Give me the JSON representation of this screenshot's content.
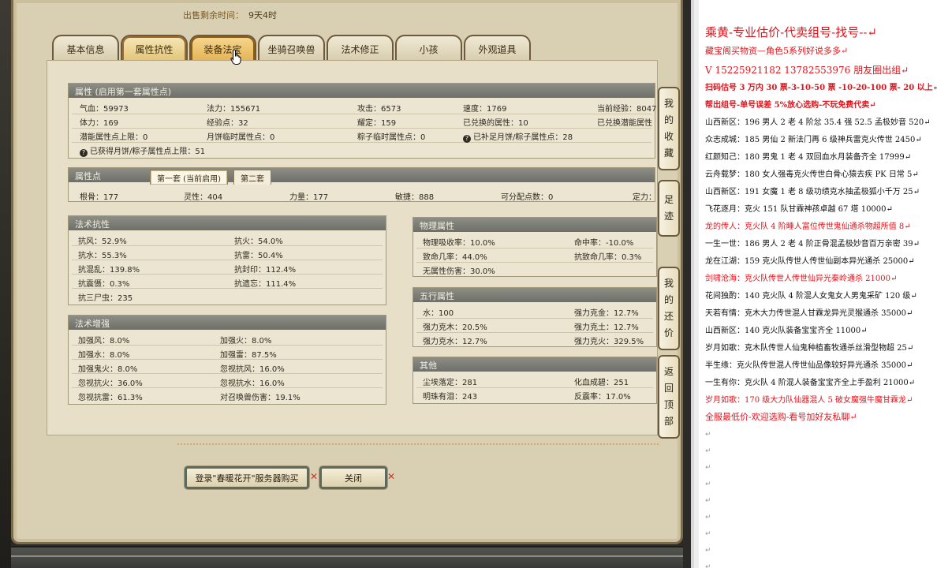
{
  "game": {
    "sale_time_label": "出售剩余时间：",
    "sale_time_value": "9天4时",
    "tabs": [
      "基本信息",
      "属性抗性",
      "装备法宝",
      "坐骑召唤兽",
      "法术修正",
      "小孩",
      "外观道具"
    ],
    "active_tab": "装备法宝",
    "attributes": {
      "header": "属性 (启用第一套属性点)",
      "rows": [
        [
          "气血：59973",
          "法力：155671",
          "攻击：6573",
          "速度：1769",
          "当前经验：8047"
        ],
        [
          "体力：169",
          "经验点：32",
          "耀定：159",
          "已兑换的属性：10",
          "已兑换潜能属性"
        ],
        [
          "潜能属性点上限：0",
          "月饼临时属性点：0",
          "粽子临时属性点：0",
          "已补足月饼/粽子属性点：28",
          ""
        ]
      ],
      "note": "已获得月饼/粽子属性点上限：51"
    },
    "points": {
      "header": "属性点",
      "subtabs": [
        "第一套 (当前启用)",
        "第二套"
      ],
      "row": [
        "根骨：177",
        "灵性：404",
        "力量：177",
        "敏捷：888",
        "可分配点数：0",
        "定力："
      ]
    },
    "resist": {
      "header": "法术抗性",
      "rows": [
        [
          "抗风：52.9%",
          "抗火：54.0%"
        ],
        [
          "抗水：55.3%",
          "抗雷：50.4%"
        ],
        [
          "抗混乱：139.8%",
          "抗封印：112.4%"
        ],
        [
          "抗震慑：0.3%",
          "抗遗忘：111.4%"
        ],
        [
          "抗三尸虫：235",
          ""
        ]
      ]
    },
    "boost": {
      "header": "法术增强",
      "rows": [
        [
          "加强风：8.0%",
          "加强火：8.0%"
        ],
        [
          "加强水：8.0%",
          "加强雷：87.5%"
        ],
        [
          "加强鬼火：8.0%",
          "忽视抗风：16.0%"
        ],
        [
          "忽视抗火：36.0%",
          "忽视抗水：16.0%"
        ],
        [
          "忽视抗雷：61.3%",
          "对召唤兽伤害：19.1%"
        ]
      ]
    },
    "physical": {
      "header": "物理属性",
      "rows": [
        [
          "物理吸收率：10.0%",
          "命中率：-10.0%"
        ],
        [
          "致命几率：44.0%",
          "抗致命几率：0.3%"
        ],
        [
          "无属性伤害：30.0%",
          ""
        ]
      ]
    },
    "wuxing": {
      "header": "五行属性",
      "rows": [
        [
          "水：100",
          "强力克金：12.7%"
        ],
        [
          "强力克木：20.5%",
          "强力克土：12.7%"
        ],
        [
          "强力克水：12.7%",
          "强力克火：329.5%"
        ]
      ]
    },
    "other": {
      "header": "其他",
      "rows": [
        [
          "尘埃落定：281",
          "化血成碧：251"
        ],
        [
          "明珠有泪：243",
          "反震率：17.0%"
        ]
      ]
    },
    "side_buttons": [
      "我的收藏",
      "足迹",
      "我的还价",
      "返回顶部"
    ],
    "buy_button": "登录\"春暖花开\"服务器购买",
    "close_button": "关闭"
  },
  "doc": {
    "lines": [
      {
        "text": "乘黄-专业估价-代卖组号-找号--",
        "color": "#e0141c",
        "size": 15,
        "bold": false
      },
      {
        "text": "藏宝阁买物资—角色5系列好说多多",
        "color": "#e0141c",
        "size": 11,
        "bold": false
      },
      {
        "text": "V 15225921182   13782553976 朋友圈出组",
        "color": "#e0141c",
        "size": 12,
        "bold": false
      },
      {
        "text": "扫码估号 3 万内 30 票-3-10-50 票 -10-20-100 票- 20 以上",
        "color": "#e0141c",
        "size": 10,
        "bold": true
      },
      {
        "text": "帮出组号-单号误差 5%放心选购-不玩免费代卖",
        "color": "#e0141c",
        "size": 10,
        "bold": true
      },
      {
        "text": "山西新区：196 男人 2 老 4 阶忿 35.4 强 52.5 孟极妙音 520",
        "color": "#111111",
        "size": 10,
        "bold": false
      },
      {
        "text": "众志成城：185 男仙 2 新法门再 6 级神兵雷克火传世 2450",
        "color": "#111111",
        "size": 10,
        "bold": false
      },
      {
        "text": "红颜知己：180 男鬼 1 老 4 双回血水月装备齐全 17999",
        "color": "#111111",
        "size": 10,
        "bold": false
      },
      {
        "text": "云舟载梦：180 女人强毒克火传世白骨心猿去疾 PK 日常 5",
        "color": "#111111",
        "size": 10,
        "bold": false
      },
      {
        "text": "山西新区：191 女魔 1 老 8 级功绩克水抽孟极狐小千万 25",
        "color": "#111111",
        "size": 10,
        "bold": false
      },
      {
        "text": "飞花逐月：克火 151 队甘霖神孩卓越 67 塔 10000",
        "color": "#111111",
        "size": 10,
        "bold": false
      },
      {
        "text": "龙的传人：克火队 4 阶睡人富位传世鬼仙通杀物超所值 8",
        "color": "#e0141c",
        "size": 10,
        "bold": false
      },
      {
        "text": "一生一世：186 男人 2 老 4 阶正骨混孟极妙音百万亲密 39",
        "color": "#111111",
        "size": 10,
        "bold": false
      },
      {
        "text": "龙在江湖：159 克火队传世人传世仙副本异光通杀 25000",
        "color": "#111111",
        "size": 10,
        "bold": false
      },
      {
        "text": "剑啸沧海：克火队传世人传世仙异光秦岭通杀 21000",
        "color": "#e0141c",
        "size": 10,
        "bold": false
      },
      {
        "text": "花间独酌：140 克火队 4 阶混人女鬼女人男鬼采矿 120 级",
        "color": "#111111",
        "size": 10,
        "bold": false
      },
      {
        "text": "天若有情：克木大力传世混人甘霖龙异光灵猴通杀 35000",
        "color": "#111111",
        "size": 10,
        "bold": false
      },
      {
        "text": "山西新区：140 克火队装备宝宝齐全 11000",
        "color": "#111111",
        "size": 10,
        "bold": false
      },
      {
        "text": "岁月如歌：克木队传世人仙鬼种植畜牧通杀丝滑型物超 25",
        "color": "#111111",
        "size": 10,
        "bold": false
      },
      {
        "text": "半生缘：克火队传世混人传世仙品像较好异光通杀 35000",
        "color": "#111111",
        "size": 10,
        "bold": false
      },
      {
        "text": "一生有你：克火队 4 阶混人装备宝宝齐全上手盈利 21000",
        "color": "#111111",
        "size": 10,
        "bold": false
      },
      {
        "text": "岁月如歌：170 级大力队仙器混人 5 破女魔强牛魔甘霖龙",
        "color": "#e0141c",
        "size": 10,
        "bold": false
      },
      {
        "text": "全服最低价-欢迎选购-看号加好友私聊",
        "color": "#e0141c",
        "size": 11,
        "bold": false
      }
    ],
    "para_mark": "↵"
  }
}
